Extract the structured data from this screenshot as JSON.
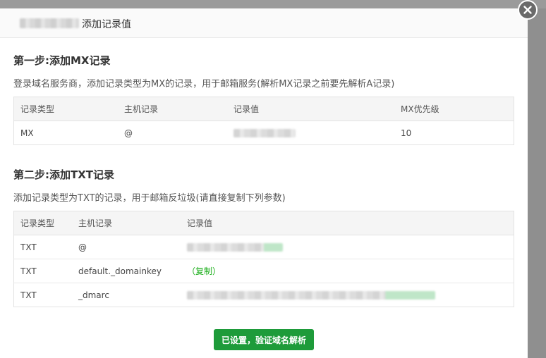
{
  "dialog": {
    "title": "添加记录值",
    "close_icon": "close-icon"
  },
  "step1": {
    "title": "第一步:添加MX记录",
    "desc": "登录域名服务商，添加记录类型为MX的记录，用于邮箱服务(解析MX记录之前要先解析A记录)",
    "headers": [
      "记录类型",
      "主机记录",
      "记录值",
      "MX优先级"
    ],
    "rows": [
      {
        "type": "MX",
        "host": "@",
        "value": "",
        "priority": "10"
      }
    ]
  },
  "step2": {
    "title": "第二步:添加TXT记录",
    "desc": "添加记录类型为TXT的记录，用于邮箱反垃圾(请直接复制下列参数)",
    "headers": [
      "记录类型",
      "主机记录",
      "记录值"
    ],
    "rows": [
      {
        "type": "TXT",
        "host": "@",
        "value": ""
      },
      {
        "type": "TXT",
        "host": "default._domainkey",
        "value": "（复制）"
      },
      {
        "type": "TXT",
        "host": "_dmarc",
        "value": ""
      }
    ]
  },
  "actions": {
    "verify_label": "已设置，验证域名解析"
  },
  "colors": {
    "accent_green": "#1e9b3a",
    "link_green": "#1aad19"
  }
}
